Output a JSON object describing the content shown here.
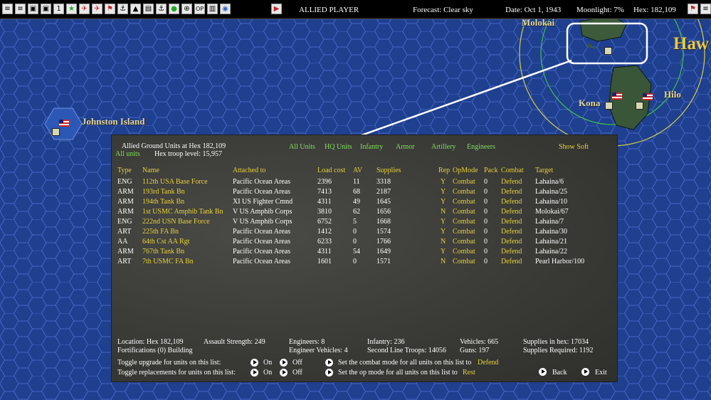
{
  "toolbar": {
    "buttons": [
      "≡",
      "≡",
      "▣",
      "▣",
      "1",
      "★",
      "✈",
      "✈",
      "⚑",
      "⚓",
      "▲",
      "▤",
      "⚓",
      "●",
      "⊕",
      "OP",
      "▥",
      "◉",
      "▶"
    ],
    "side_label": "ALLIED PLAYER",
    "forecast": "Forecast: Clear sky",
    "date": "Date: Oct 1, 1943",
    "moonlight": "Moonlight: 7%",
    "hex": "Hex: 182,109"
  },
  "map": {
    "labels": {
      "molokai": "Molokai",
      "hawaii": "Haw",
      "hilo": "Hilo",
      "kona": "Kona",
      "johnston": "Johnston Island"
    },
    "colors": {
      "ocean": "#1f3f8f",
      "hex_line": "#3f5fb8",
      "range_green": "#3ec83e",
      "range_yellow": "#d8d040"
    }
  },
  "dialog": {
    "title": "Allied Ground Units at Hex 182,109",
    "all_units_label": "All units",
    "troop_level": "Hex troop level: 15,957",
    "filters": [
      "All Units",
      "HQ Units",
      "Infantry",
      "Armor",
      "Artillery",
      "Engineers"
    ],
    "show_soft": "Show Soft",
    "columns": [
      "Type",
      "Name",
      "Attached to",
      "Load cost",
      "AV",
      "Supplies",
      "Rep",
      "OpMode",
      "Pack",
      "Combat",
      "Target"
    ],
    "rows": [
      [
        "ENG",
        "112th USA Base Force",
        "Pacific Ocean Areas",
        "2396",
        "11",
        "3318",
        "Y",
        "Combat",
        "0",
        "Defend",
        "Lahaina/6"
      ],
      [
        "ARM",
        "193rd Tank Bn",
        "Pacific Ocean Areas",
        "7413",
        "68",
        "2187",
        "Y",
        "Combat",
        "0",
        "Defend",
        "Lahaina/25"
      ],
      [
        "ARM",
        "194th Tank Bn",
        "XI US Fighter Cmnd",
        "4311",
        "49",
        "1645",
        "Y",
        "Combat",
        "0",
        "Defend",
        "Lahaina/10"
      ],
      [
        "ARM",
        "1st USMC Amphib Tank Bn",
        "V US Amphib Corps",
        "3810",
        "62",
        "1656",
        "N",
        "Combat",
        "0",
        "Defend",
        "Molokai/67"
      ],
      [
        "ENG",
        "222nd USN Base Force",
        "V US Amphib Corps",
        "6752",
        "5",
        "1668",
        "Y",
        "Combat",
        "0",
        "Defend",
        "Lahaina/7"
      ],
      [
        "ART",
        "225th FA Bn",
        "Pacific Ocean Areas",
        "1412",
        "0",
        "1574",
        "Y",
        "Combat",
        "0",
        "Defend",
        "Lahaina/30"
      ],
      [
        "AA",
        "64th Cst AA Rgt",
        "Pacific Ocean Areas",
        "6233",
        "0",
        "1766",
        "N",
        "Combat",
        "0",
        "Defend",
        "Lahaina/21"
      ],
      [
        "ARM",
        "767th Tank Bn",
        "Pacific Ocean Areas",
        "4311",
        "54",
        "1649",
        "Y",
        "Combat",
        "0",
        "Defend",
        "Lahaina/22"
      ],
      [
        "ART",
        "7th USMC FA Bn",
        "Pacific Ocean Areas",
        "1601",
        "0",
        "1571",
        "N",
        "Combat",
        "0",
        "Defend",
        "Pearl Harbor/100"
      ]
    ],
    "summary": {
      "location": "Location: Hex 182,109",
      "assault": "Assault Strength: 249",
      "engineers": "Engineers: 8",
      "infantry": "Infantry: 236",
      "vehicles": "Vehicles: 665",
      "supplies_in_hex": "Supplies in hex: 17034",
      "fortifications": "Fortifications (0) Building",
      "engineer_vehicles": "Engineer Vehicles: 4",
      "second_line": "Second Line Troops: 14056",
      "guns": "Guns: 197",
      "supplies_required": "Supplies Required: 1192"
    },
    "controls": {
      "toggle_upgrade": "Toggle upgrade for units on this list:",
      "toggle_replacements": "Toggle replacements for units on this list:",
      "on": "On",
      "off": "Off",
      "set_combat": "Set the combat mode for all units on this list to",
      "combat_value": "Defend",
      "set_op": "Set the op mode for all units on this list to",
      "op_value": "Rest",
      "back": "Back",
      "exit": "Exit"
    }
  }
}
